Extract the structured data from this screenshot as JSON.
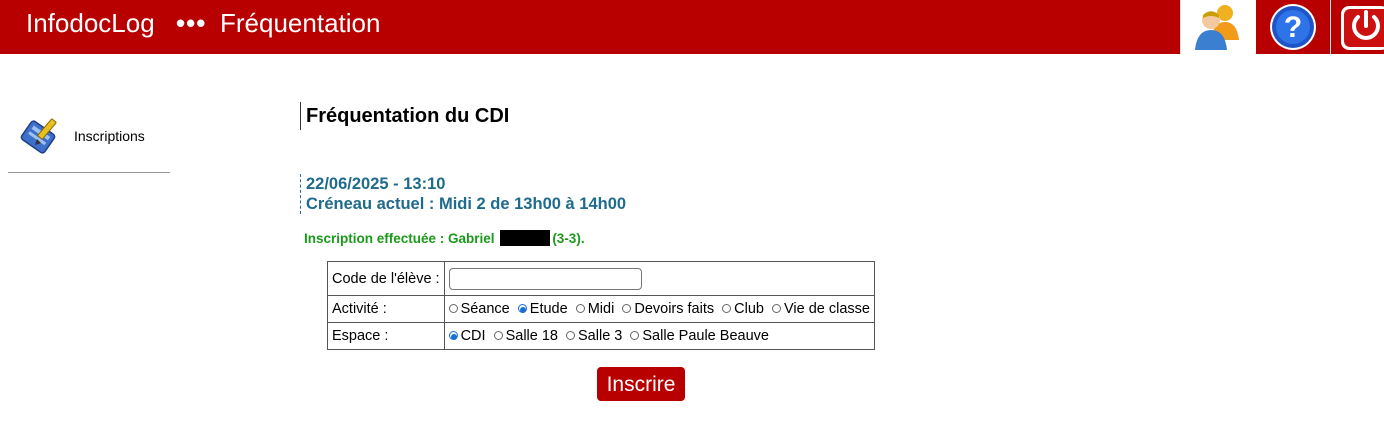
{
  "header": {
    "app_title": "InfodocLog",
    "separator": "•••",
    "section_title": "Fréquentation",
    "buttons": [
      {
        "icon": "users-icon"
      },
      {
        "icon": "help-icon"
      },
      {
        "icon": "power-icon"
      }
    ],
    "brand_color": "#b80000"
  },
  "sidebar": {
    "items": [
      {
        "label": "Inscriptions",
        "icon": "inscriptions-icon"
      }
    ]
  },
  "main": {
    "page_title": "Fréquentation du CDI",
    "datetime": "22/06/2025 - 13:10",
    "slot": "Créneau actuel : Midi 2 de 13h00 à 14h00",
    "success": {
      "prefix": "Inscription effectuée : Gabriel",
      "suffix": "(3-3)."
    },
    "form": {
      "code_label": "Code de l'élève :",
      "code_value": "",
      "activity_label": "Activité :",
      "activity_options": [
        "Séance",
        "Etude",
        "Midi",
        "Devoirs faits",
        "Club",
        "Vie de classe"
      ],
      "activity_selected": "Etude",
      "space_label": "Espace :",
      "space_options": [
        "CDI",
        "Salle 18",
        "Salle 3",
        "Salle Paule Beauve"
      ],
      "space_selected": "CDI",
      "submit_label": "Inscrire"
    }
  }
}
